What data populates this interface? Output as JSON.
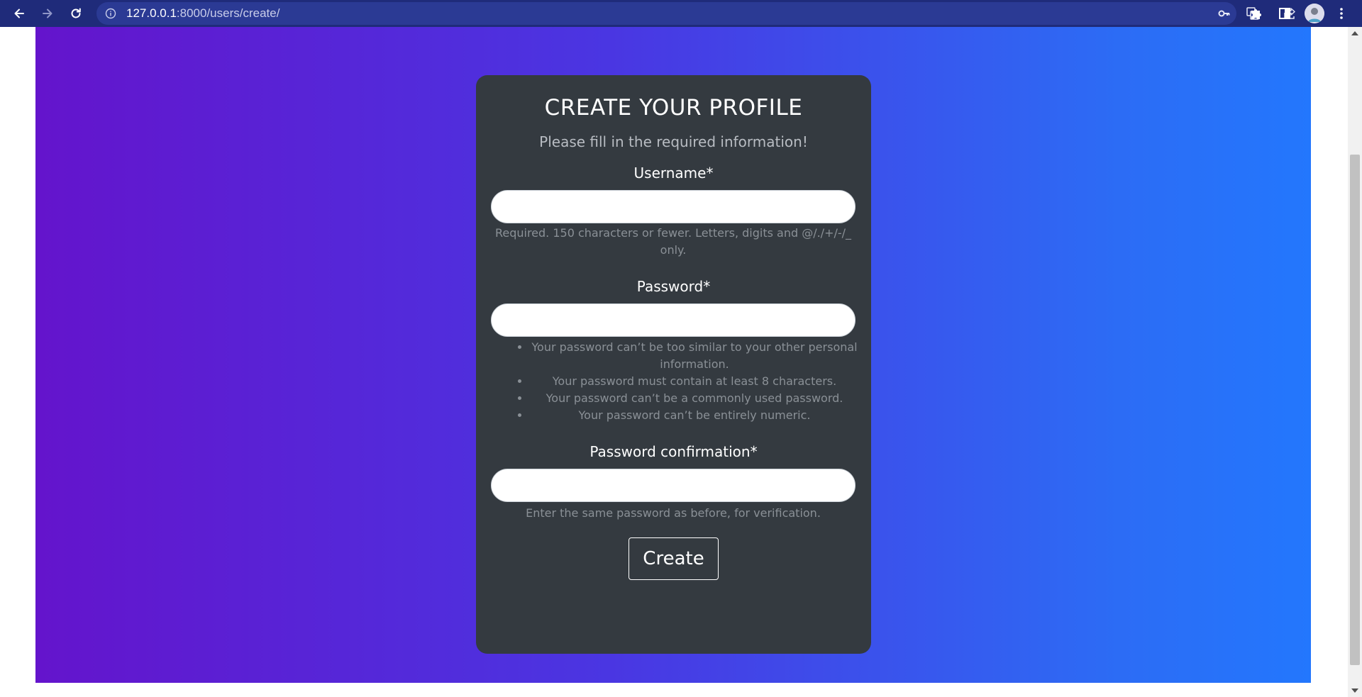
{
  "browser": {
    "url_host": "127.0.0.1",
    "url_path": ":8000/users/create/",
    "icons": {
      "back": "back-arrow-icon",
      "forward": "forward-arrow-icon",
      "reload": "reload-icon",
      "info": "info-icon",
      "key": "key-icon",
      "translate": "translate-icon",
      "share": "share-icon",
      "bookmark": "star-icon",
      "extensions": "puzzle-icon",
      "side_panel": "side-panel-icon",
      "profile": "avatar",
      "menu": "kebab-menu-icon"
    }
  },
  "form": {
    "title": "CREATE YOUR PROFILE",
    "subtitle": "Please fill in the required information!",
    "username": {
      "label": "Username*",
      "value": "",
      "help": "Required. 150 characters or fewer. Letters, digits and @/./+/-/_ only."
    },
    "password": {
      "label": "Password*",
      "value": "",
      "help_items": [
        "Your password can’t be too similar to your other personal information.",
        "Your password must contain at least 8 characters.",
        "Your password can’t be a commonly used password.",
        "Your password can’t be entirely numeric."
      ]
    },
    "password_confirmation": {
      "label": "Password confirmation*",
      "value": "",
      "help": "Enter the same password as before, for verification."
    },
    "submit_label": "Create"
  },
  "colors": {
    "chrome_bg": "#1f2b7a",
    "gradient_start": "#6414cc",
    "gradient_end": "#2377fd",
    "card_bg": "#343a40",
    "help_text": "#8a9096"
  }
}
